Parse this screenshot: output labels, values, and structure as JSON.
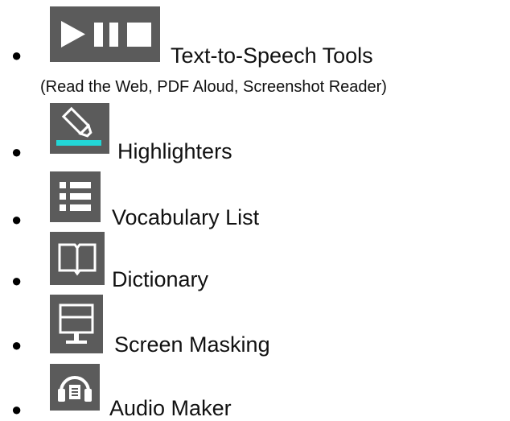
{
  "items": [
    {
      "icon": "play-pause-stop-icon",
      "label": "Text-to-Speech Tools",
      "sublabel": "(Read the Web, PDF Aloud, Screenshot Reader)"
    },
    {
      "icon": "highlighter-icon",
      "label": "Highlighters"
    },
    {
      "icon": "vocabulary-list-icon",
      "label": "Vocabulary List"
    },
    {
      "icon": "dictionary-book-icon",
      "label": "Dictionary"
    },
    {
      "icon": "screen-masking-icon",
      "label": "Screen Masking"
    },
    {
      "icon": "audio-maker-headphones-icon",
      "label": "Audio Maker"
    }
  ],
  "bullet_char": "●",
  "colors": {
    "icon_bg": "#5b5b5b",
    "icon_fg": "#ffffff",
    "highlighter_accent": "#22d6d6",
    "text": "#111111"
  }
}
